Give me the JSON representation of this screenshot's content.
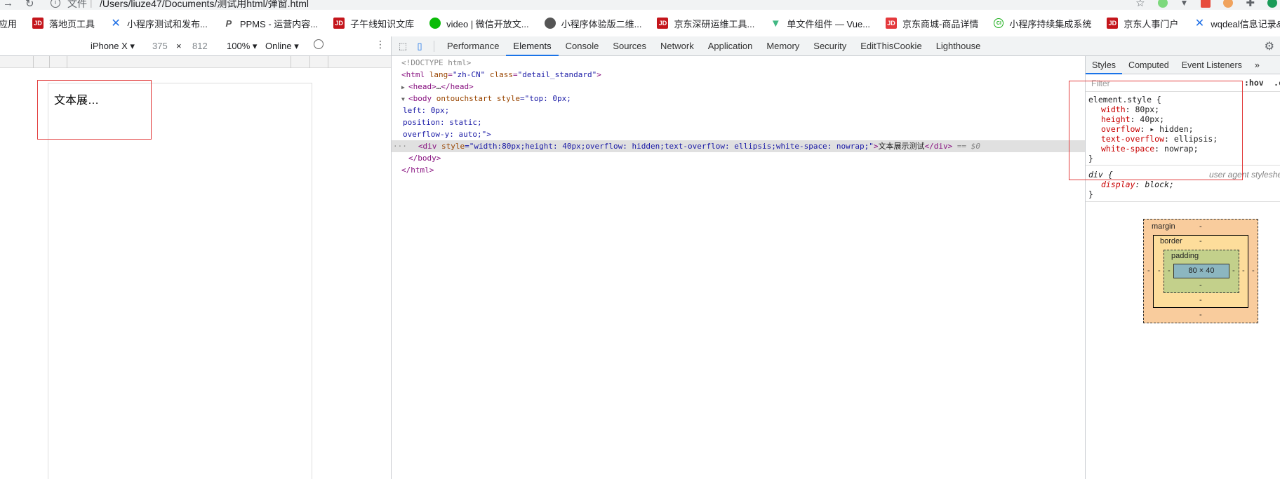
{
  "address_bar": {
    "scheme": "文件",
    "url": "/Users/liuze47/Documents/测试用html/弹窗.html"
  },
  "bookmarks": [
    {
      "icon": "apps-icon",
      "label": "应用"
    },
    {
      "icon": "jd-icon",
      "label": "落地页工具"
    },
    {
      "icon": "blue-x-icon",
      "label": "小程序测试和发布..."
    },
    {
      "icon": "p-icon",
      "label": "PPMS - 运营内容..."
    },
    {
      "icon": "jd-icon",
      "label": "子午线知识文库"
    },
    {
      "icon": "wechat-icon",
      "label": "video | 微信开放文..."
    },
    {
      "icon": "globe-icon",
      "label": "小程序体验版二维..."
    },
    {
      "icon": "jd-icon",
      "label": "京东深研运维工具..."
    },
    {
      "icon": "vue-icon",
      "label": "单文件组件 — Vue..."
    },
    {
      "icon": "jd-red-icon",
      "label": "京东商城-商品详情"
    },
    {
      "icon": "ci-icon",
      "label": "小程序持续集成系统"
    },
    {
      "icon": "jd-icon",
      "label": "京东人事门户"
    },
    {
      "icon": "blue-x-icon",
      "label": "wqdeal信息记录&..."
    }
  ],
  "device_toolbar": {
    "device": "iPhone X ▾",
    "width": "375",
    "times": "×",
    "height": "812",
    "zoom": "100% ▾",
    "network": "Online ▾"
  },
  "page": {
    "text": "文本展示测试"
  },
  "devtools": {
    "tabs": [
      "Performance",
      "Elements",
      "Console",
      "Sources",
      "Network",
      "Application",
      "Memory",
      "Security",
      "EditThisCookie",
      "Lighthouse"
    ],
    "active_tab": "Elements"
  },
  "dom": {
    "doctype": "<!DOCTYPE html>",
    "html_open": {
      "tag": "<html",
      "a1": " lang",
      "v1": "\"zh-CN\"",
      "a2": " class",
      "v2": "\"detail_standard\"",
      "end": ">"
    },
    "head": {
      "tri": "▶",
      "tag": "<head>",
      "ell": "…",
      "close": "</head>"
    },
    "body_open": {
      "tri": "▼",
      "tag": "<body",
      "a1": " ontouchstart",
      "a2": " style",
      "v2": "=\"top: 0px;"
    },
    "body_style_2": "left: 0px;",
    "body_style_3": "position: static;",
    "body_style_4": "overflow-y: auto;\">",
    "div_line": {
      "dots": "···",
      "tag": "<div",
      "attr": " style",
      "val": "=\"width:80px;height: 40px;overflow: hidden;text-overflow: ellipsis;white-space: nowrap;\"",
      "end": ">",
      "text": "文本展示测试",
      "close": "</div>",
      "eq": " == $0"
    },
    "body_close": "</body>",
    "html_close": "</html>"
  },
  "styles_panel": {
    "tabs": [
      "Styles",
      "Computed",
      "Event Listeners",
      "»"
    ],
    "active_tab": "Styles",
    "filter_placeholder": "Filter",
    "hov": ":hov",
    "cls": ".cls",
    "element_style_selector": "element.style {",
    "element_style_props": [
      {
        "name": "width",
        "value": "80px;"
      },
      {
        "name": "height",
        "value": "40px;"
      },
      {
        "name": "overflow",
        "value": "▸ hidden;"
      },
      {
        "name": "text-overflow",
        "value": "ellipsis;"
      },
      {
        "name": "white-space",
        "value": "nowrap;"
      }
    ],
    "close_brace": "}",
    "ua_selector": "div {",
    "ua_label": "user agent stylesheet",
    "ua_props": [
      {
        "name": "display",
        "value": "block;"
      }
    ]
  },
  "box_model": {
    "margin_label": "margin",
    "border_label": "border",
    "padding_label": "padding",
    "content": "80 × 40",
    "dash": "-"
  }
}
